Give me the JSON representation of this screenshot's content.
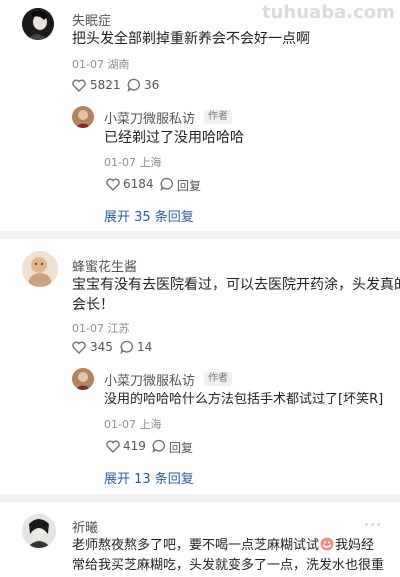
{
  "watermark": "tuhuaba.com",
  "comments": [
    {
      "user": "失眠症",
      "text_lines": [
        "把头发全部剃掉重新养会不会好一点啊"
      ],
      "date_location": "01-07 湖南",
      "likes": "5821",
      "replies_count": "36",
      "reply": {
        "user": "小菜刀微服私访",
        "badge": "作者",
        "text": "已经剃过了没用哈哈哈",
        "date_location": "01-07 上海",
        "likes": "6184",
        "reply_label": "回复"
      },
      "expand_label": "展开 35 条回复"
    },
    {
      "user": "蜂蜜花生酱",
      "text_lines": [
        "宝宝有没有去医院看过，可以去医院开药涂，头发真的",
        "会长！"
      ],
      "date_location": "01-07 江苏",
      "likes": "345",
      "replies_count": "14",
      "reply": {
        "user": "小菜刀微服私访",
        "badge": "作者",
        "text": "没用的哈哈哈什么方法包括手术都试过了[坏笑R]",
        "date_location": "01-07 上海",
        "likes": "419",
        "reply_label": "回复"
      },
      "expand_label": "展开 13 条回复"
    },
    {
      "user": "祈曦",
      "text_lines": [
        "老师熬夜熬多了吧，要不喝一点芝麻糊试试",
        "我妈经",
        "常给我买芝麻糊吃，头发就变多了一点，洗发水也很重"
      ]
    }
  ],
  "more_glyph": "···"
}
